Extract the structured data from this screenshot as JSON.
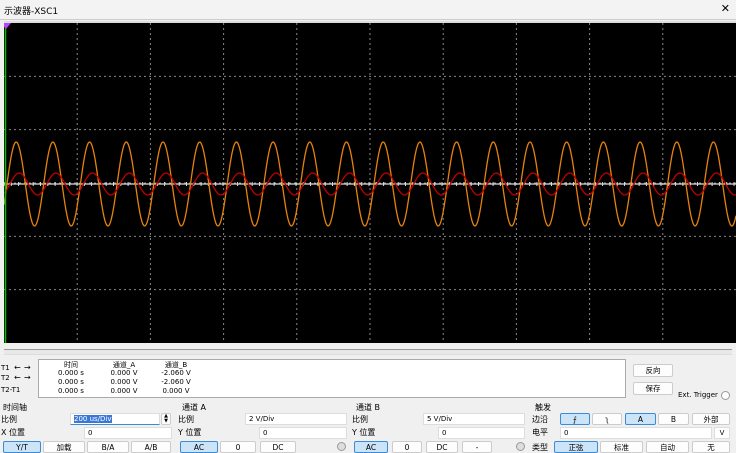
{
  "window": {
    "title": "示波器-XSC1",
    "close": "✕"
  },
  "cursors": {
    "labels": [
      "T1",
      "T2",
      "T2-T1"
    ],
    "headers": [
      "时间",
      "通道_A",
      "通道_B"
    ],
    "rows": [
      [
        "0.000 s",
        "0.000 V",
        "-2.060 V"
      ],
      [
        "0.000 s",
        "0.000 V",
        "-2.060 V"
      ],
      [
        "0.000 s",
        "0.000 V",
        "0.000 V"
      ]
    ]
  },
  "buttons": {
    "reverse": "反向",
    "save": "保存",
    "ext_trigger": "Ext. Trigger"
  },
  "timebase": {
    "title": "时间轴",
    "scale_label": "比例",
    "scale": "200 us/Div",
    "xpos_label": "X 位置",
    "xpos": "0",
    "modes": [
      "Y/T",
      "加载",
      "B/A",
      "A/B"
    ],
    "active_mode": "Y/T"
  },
  "channel_a": {
    "title": "通道 A",
    "scale_label": "比例",
    "scale": "2  V/Div",
    "ypos_label": "Y 位置",
    "ypos": "0",
    "coupling": [
      "AC",
      "0",
      "DC"
    ],
    "active": "AC"
  },
  "channel_b": {
    "title": "通道 B",
    "scale_label": "比例",
    "scale": "5  V/Div",
    "ypos_label": "Y 位置",
    "ypos": "0",
    "coupling": [
      "AC",
      "0",
      "DC",
      "-"
    ],
    "active": "AC"
  },
  "trigger": {
    "title": "触发",
    "edge_label": "边沿",
    "edges": [
      "rising-edge",
      "falling-edge"
    ],
    "sources": [
      "A",
      "B",
      "外部"
    ],
    "active_source": "A",
    "level_label": "电平",
    "level": "0",
    "level_unit": "V",
    "type_label": "类型",
    "types": [
      "正弦",
      "标准",
      "自动",
      "无"
    ],
    "active_type": "正弦"
  },
  "colors": {
    "trace_orange": "#e8820c",
    "trace_red": "#c00000",
    "cursor": "#00c000",
    "screen": "#000000"
  }
}
